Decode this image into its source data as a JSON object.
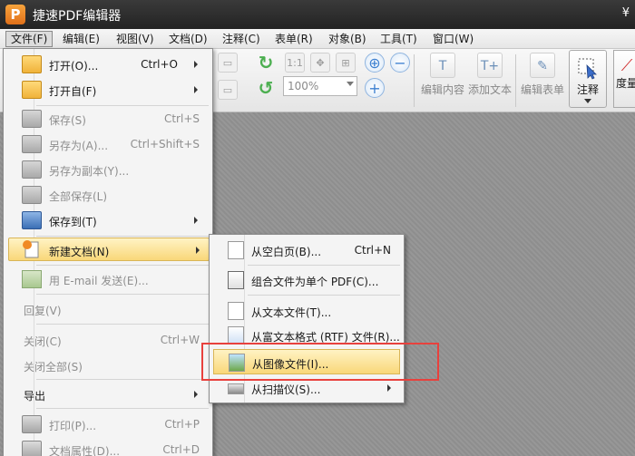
{
  "window": {
    "app_icon_letter": "P",
    "title": "捷速PDF编辑器",
    "corner_glyph": "¥"
  },
  "menubar": [
    {
      "label": "文件(F)",
      "active": true
    },
    {
      "label": "编辑(E)"
    },
    {
      "label": "视图(V)"
    },
    {
      "label": "文档(D)"
    },
    {
      "label": "注释(C)"
    },
    {
      "label": "表单(R)"
    },
    {
      "label": "对象(B)"
    },
    {
      "label": "工具(T)"
    },
    {
      "label": "窗口(W)"
    }
  ],
  "toolbar": {
    "zoom_value": "100%",
    "edit_content": "编辑内容",
    "add_text": "添加文本",
    "edit_form": "编辑表单",
    "annotate": "注释",
    "measure": "度量"
  },
  "file_menu": {
    "items": [
      {
        "label": "打开(O)...",
        "shortcut": "Ctrl+O",
        "icon": "folder-open-icon"
      },
      {
        "label": "打开自(F)",
        "submenu": true,
        "icon": "folder-from-icon"
      },
      {
        "label": "保存(S)",
        "shortcut": "Ctrl+S",
        "disabled": true,
        "icon": "save-icon"
      },
      {
        "label": "另存为(A)...",
        "shortcut": "Ctrl+Shift+S",
        "disabled": true,
        "icon": "save-as-icon"
      },
      {
        "label": "另存为副本(Y)...",
        "disabled": true,
        "icon": "save-copy-icon"
      },
      {
        "label": "全部保存(L)",
        "disabled": true,
        "icon": "save-all-icon"
      },
      {
        "label": "保存到(T)",
        "submenu": true,
        "icon": "save-to-icon"
      },
      {
        "label": "新建文档(N)",
        "submenu": true,
        "highlighted": true,
        "icon": "new-document-icon"
      },
      {
        "label": "用 E-mail 发送(E)...",
        "disabled": true,
        "icon": "email-icon"
      },
      {
        "label": "回复(V)",
        "disabled": true
      },
      {
        "label": "关闭(C)",
        "shortcut": "Ctrl+W",
        "disabled": true
      },
      {
        "label": "关闭全部(S)",
        "disabled": true
      },
      {
        "label": "导出",
        "submenu": true
      },
      {
        "label": "打印(P)...",
        "shortcut": "Ctrl+P",
        "disabled": true,
        "icon": "print-icon"
      },
      {
        "label": "文档属性(D)...",
        "shortcut": "Ctrl+D",
        "disabled": true,
        "icon": "document-properties-icon"
      }
    ]
  },
  "new_doc_submenu": {
    "items": [
      {
        "label": "从空白页(B)...",
        "shortcut": "Ctrl+N"
      },
      {
        "label": "组合文件为单个 PDF(C)..."
      },
      {
        "label": "从文本文件(T)..."
      },
      {
        "label": "从富文本格式 (RTF) 文件(R)..."
      },
      {
        "label": "从图像文件(I)...",
        "highlighted": true
      },
      {
        "label": "从扫描仪(S)...",
        "submenu": true
      }
    ]
  },
  "colors": {
    "highlight": "#f9d779",
    "annotation_box": "#e8413d",
    "accent_orange": "#e0701a"
  }
}
